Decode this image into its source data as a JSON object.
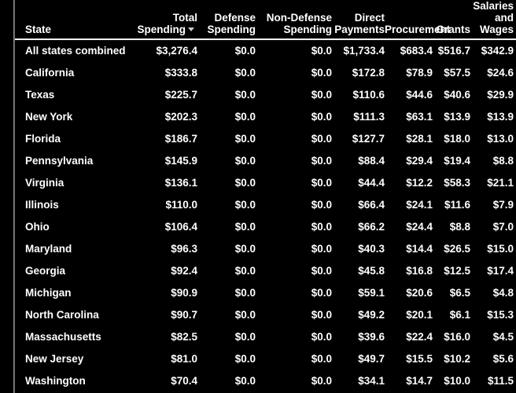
{
  "table": {
    "sort": {
      "column": "Total Spending",
      "direction": "descending",
      "caret_glyph": "▾"
    },
    "columns": [
      {
        "key": "state",
        "line1": "",
        "line2": "State",
        "line3": "",
        "align": "left"
      },
      {
        "key": "total",
        "line1": "Total",
        "line2": "Spending",
        "line3": "",
        "align": "right"
      },
      {
        "key": "defense",
        "line1": "Defense",
        "line2": "Spending",
        "line3": "",
        "align": "right"
      },
      {
        "key": "nondef",
        "line1": "Non-Defense",
        "line2": "Spending",
        "line3": "",
        "align": "right"
      },
      {
        "key": "direct",
        "line1": "Direct",
        "line2": "Payments",
        "line3": "",
        "align": "right"
      },
      {
        "key": "proc",
        "line1": "",
        "line2": "Procurement",
        "line3": "",
        "align": "right"
      },
      {
        "key": "grants",
        "line1": "",
        "line2": "Grants",
        "line3": "",
        "align": "right"
      },
      {
        "key": "salwag",
        "line1": "Salaries",
        "line2": "and",
        "line3": "Wages",
        "align": "right"
      }
    ],
    "rows": [
      {
        "state": "All states combined",
        "total": "$3,276.4",
        "defense": "$0.0",
        "nondef": "$0.0",
        "direct": "$1,733.4",
        "proc": "$683.4",
        "grants": "$516.7",
        "salwag": "$342.9"
      },
      {
        "state": "California",
        "total": "$333.8",
        "defense": "$0.0",
        "nondef": "$0.0",
        "direct": "$172.8",
        "proc": "$78.9",
        "grants": "$57.5",
        "salwag": "$24.6"
      },
      {
        "state": "Texas",
        "total": "$225.7",
        "defense": "$0.0",
        "nondef": "$0.0",
        "direct": "$110.6",
        "proc": "$44.6",
        "grants": "$40.6",
        "salwag": "$29.9"
      },
      {
        "state": "New York",
        "total": "$202.3",
        "defense": "$0.0",
        "nondef": "$0.0",
        "direct": "$111.3",
        "proc": "$63.1",
        "grants": "$13.9",
        "salwag": "$13.9"
      },
      {
        "state": "Florida",
        "total": "$186.7",
        "defense": "$0.0",
        "nondef": "$0.0",
        "direct": "$127.7",
        "proc": "$28.1",
        "grants": "$18.0",
        "salwag": "$13.0"
      },
      {
        "state": "Pennsylvania",
        "total": "$145.9",
        "defense": "$0.0",
        "nondef": "$0.0",
        "direct": "$88.4",
        "proc": "$29.4",
        "grants": "$19.4",
        "salwag": "$8.8"
      },
      {
        "state": "Virginia",
        "total": "$136.1",
        "defense": "$0.0",
        "nondef": "$0.0",
        "direct": "$44.4",
        "proc": "$12.2",
        "grants": "$58.3",
        "salwag": "$21.1"
      },
      {
        "state": "Illinois",
        "total": "$110.0",
        "defense": "$0.0",
        "nondef": "$0.0",
        "direct": "$66.4",
        "proc": "$24.1",
        "grants": "$11.6",
        "salwag": "$7.9"
      },
      {
        "state": "Ohio",
        "total": "$106.4",
        "defense": "$0.0",
        "nondef": "$0.0",
        "direct": "$66.2",
        "proc": "$24.4",
        "grants": "$8.8",
        "salwag": "$7.0"
      },
      {
        "state": "Maryland",
        "total": "$96.3",
        "defense": "$0.0",
        "nondef": "$0.0",
        "direct": "$40.3",
        "proc": "$14.4",
        "grants": "$26.5",
        "salwag": "$15.0"
      },
      {
        "state": "Georgia",
        "total": "$92.4",
        "defense": "$0.0",
        "nondef": "$0.0",
        "direct": "$45.8",
        "proc": "$16.8",
        "grants": "$12.5",
        "salwag": "$17.4"
      },
      {
        "state": "Michigan",
        "total": "$90.9",
        "defense": "$0.0",
        "nondef": "$0.0",
        "direct": "$59.1",
        "proc": "$20.6",
        "grants": "$6.5",
        "salwag": "$4.8"
      },
      {
        "state": "North Carolina",
        "total": "$90.7",
        "defense": "$0.0",
        "nondef": "$0.0",
        "direct": "$49.2",
        "proc": "$20.1",
        "grants": "$6.1",
        "salwag": "$15.3"
      },
      {
        "state": "Massachusetts",
        "total": "$82.5",
        "defense": "$0.0",
        "nondef": "$0.0",
        "direct": "$39.6",
        "proc": "$22.4",
        "grants": "$16.0",
        "salwag": "$4.5"
      },
      {
        "state": "New Jersey",
        "total": "$81.0",
        "defense": "$0.0",
        "nondef": "$0.0",
        "direct": "$49.7",
        "proc": "$15.5",
        "grants": "$10.2",
        "salwag": "$5.6"
      },
      {
        "state": "Washington",
        "total": "$70.4",
        "defense": "$0.0",
        "nondef": "$0.0",
        "direct": "$34.1",
        "proc": "$14.7",
        "grants": "$10.0",
        "salwag": "$11.5"
      }
    ]
  },
  "theme": {
    "background": "#000000",
    "text": "#ffffff",
    "rule": "#ffffff",
    "rail": "#9a9a9a",
    "caret": "#c9c9c9"
  }
}
